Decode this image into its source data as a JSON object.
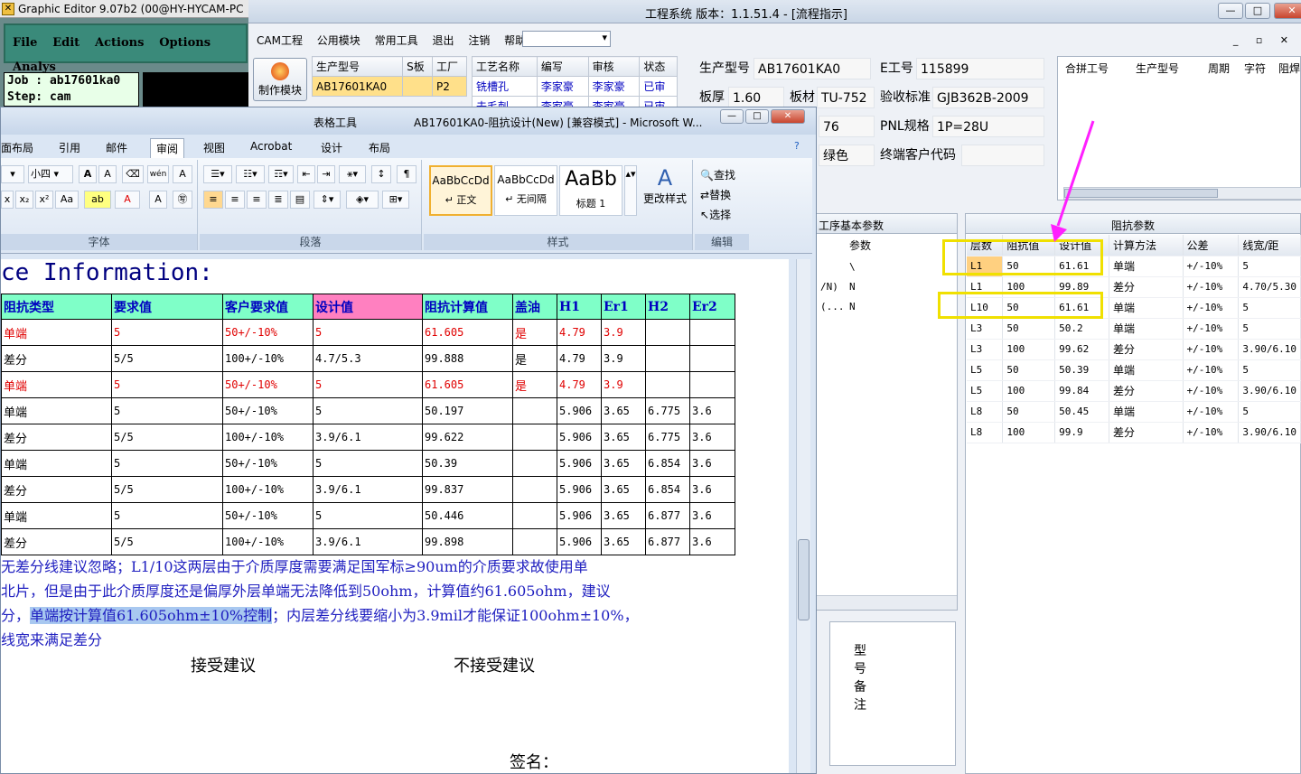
{
  "genesis": {
    "title": "Graphic Editor 9.07b2 (00@HY-HYCAM-PC",
    "menu": [
      "File",
      "Edit",
      "Actions",
      "Options",
      "Analys"
    ],
    "job_line": "Job : ab17601ka0",
    "step_line": "Step: cam"
  },
  "cam": {
    "title": "工程系统  版本：1.1.51.4 - [流程指示]",
    "menu": [
      "CAM工程",
      "公用模块",
      "常用工具",
      "退出",
      "注销",
      "帮助"
    ],
    "make_button": "制作模块",
    "tableA": {
      "headers": [
        "生产型号",
        "S板",
        "工厂"
      ],
      "rows": [
        [
          "AB17601KA0",
          "",
          "P2"
        ]
      ]
    },
    "tableB": {
      "headers": [
        "工艺名称",
        "编写",
        "审核",
        "状态"
      ],
      "rows": [
        [
          "铣槽孔",
          "李家豪",
          "李家豪",
          "已审"
        ],
        [
          "去毛刺",
          "李家豪",
          "李家豪",
          "已审"
        ]
      ]
    },
    "info": {
      "model_label": "生产型号",
      "model": "AB17601KA0",
      "eno_label": "E工号",
      "eno": "115899",
      "thick_label": "板厚",
      "thick": "1.60",
      "mat_label": "板材",
      "mat": "TU-752",
      "std_label": "验收标准",
      "std": "GJB362B-2009",
      "v76": "76",
      "pnl_label": "PNL规格",
      "pnl": "1P=28U",
      "color": "绿色",
      "cust_label": "终端客户代码",
      "cust": ""
    },
    "merge_headers": [
      "合拼工号",
      "生产型号",
      "周期",
      "字符",
      "阻焊"
    ],
    "proc": {
      "caption": "工序基本参数",
      "col": "参数",
      "rows": [
        [
          "",
          "\\"
        ],
        [
          "/N)",
          "N"
        ],
        [
          "(...",
          "N"
        ]
      ]
    },
    "remark_label": "型号备注",
    "impedance": {
      "caption": "阻抗参数",
      "headers": [
        "层数",
        "阻抗值",
        "设计值",
        "计算方法",
        "公差",
        "线宽/距"
      ],
      "rows": [
        [
          "L1",
          "50",
          "61.61",
          "单端",
          "+/-10%",
          "5"
        ],
        [
          "L1",
          "100",
          "99.89",
          "差分",
          "+/-10%",
          "4.70/5.30"
        ],
        [
          "L10",
          "50",
          "61.61",
          "单端",
          "+/-10%",
          "5"
        ],
        [
          "L3",
          "50",
          "50.2",
          "单端",
          "+/-10%",
          "5"
        ],
        [
          "L3",
          "100",
          "99.62",
          "差分",
          "+/-10%",
          "3.90/6.10"
        ],
        [
          "L5",
          "50",
          "50.39",
          "单端",
          "+/-10%",
          "5"
        ],
        [
          "L5",
          "100",
          "99.84",
          "差分",
          "+/-10%",
          "3.90/6.10"
        ],
        [
          "L8",
          "50",
          "50.45",
          "单端",
          "+/-10%",
          "5"
        ],
        [
          "L8",
          "100",
          "99.9",
          "差分",
          "+/-10%",
          "3.90/6.10"
        ]
      ]
    }
  },
  "word": {
    "context_tab": "表格工具",
    "title": "AB17601KA0-阻抗设计(New) [兼容模式] - Microsoft W...",
    "tabs": [
      "面布局",
      "引用",
      "邮件",
      "审阅",
      "视图",
      "Acrobat",
      "设计",
      "布局"
    ],
    "active_tab": "审阅",
    "font_size": "小四",
    "groups": [
      "字体",
      "段落",
      "样式",
      "编辑"
    ],
    "styles": [
      {
        "preview": "AaBbCcDd",
        "name": "↵ 正文"
      },
      {
        "preview": "AaBbCcDd",
        "name": "↵ 无间隔"
      },
      {
        "preview": "AaBb",
        "name": "标题 1"
      }
    ],
    "change_styles": "更改样式",
    "edit_items": [
      "查找",
      "替换",
      "选择"
    ],
    "heading": "ce Information:",
    "table": {
      "headers": [
        "阻抗类型",
        "要求值",
        "客户要求值",
        "设计值",
        "阻抗计算值",
        "盖油",
        "H1",
        "Er1",
        "H2",
        "Er2"
      ],
      "rows": [
        [
          "单端",
          "5",
          "50+/-10%",
          "5",
          "61.605",
          "是",
          "4.79",
          "3.9",
          "",
          ""
        ],
        [
          "差分",
          "5/5",
          "100+/-10%",
          "4.7/5.3",
          "99.888",
          "是",
          "4.79",
          "3.9",
          "",
          ""
        ],
        [
          "单端",
          "5",
          "50+/-10%",
          "5",
          "61.605",
          "是",
          "4.79",
          "3.9",
          "",
          ""
        ],
        [
          "单端",
          "5",
          "50+/-10%",
          "5",
          "50.197",
          "",
          "5.906",
          "3.65",
          "6.775",
          "3.6"
        ],
        [
          "差分",
          "5/5",
          "100+/-10%",
          "3.9/6.1",
          "99.622",
          "",
          "5.906",
          "3.65",
          "6.775",
          "3.6"
        ],
        [
          "单端",
          "5",
          "50+/-10%",
          "5",
          "50.39",
          "",
          "5.906",
          "3.65",
          "6.854",
          "3.6"
        ],
        [
          "差分",
          "5/5",
          "100+/-10%",
          "3.9/6.1",
          "99.837",
          "",
          "5.906",
          "3.65",
          "6.854",
          "3.6"
        ],
        [
          "单端",
          "5",
          "50+/-10%",
          "5",
          "50.446",
          "",
          "5.906",
          "3.65",
          "6.877",
          "3.6"
        ],
        [
          "差分",
          "5/5",
          "100+/-10%",
          "3.9/6.1",
          "99.898",
          "",
          "5.906",
          "3.65",
          "6.877",
          "3.6"
        ]
      ]
    },
    "para_lines": [
      "无差分线建议忽略；L1/10这两层由于介质厚度需要满足国军标≥90um的介质要求故使用单",
      "北片，但是由于此介质厚度还是偏厚外层单端无法降低到50ohm，计算值约61.605ohm，建议"
    ],
    "para3_a": "分，",
    "para3_hl": "单端按计算值61.605ohm±10%控制",
    "para3_b": "；内层差分线要缩小为3.9mil才能保证100ohm±10%，",
    "para4": "线宽来满足差分",
    "accept": "接受建议",
    "reject": "不接受建议",
    "sign": "签名：",
    "paragraph_mark": "↵"
  }
}
